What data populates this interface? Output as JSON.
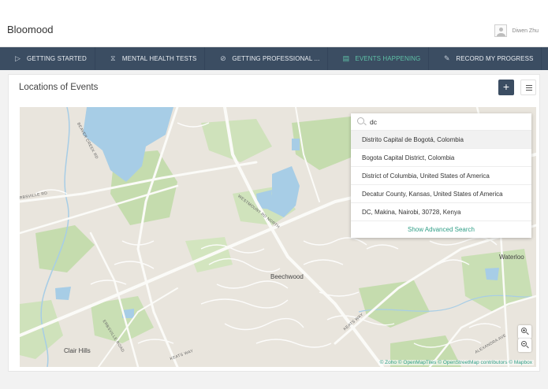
{
  "app": {
    "brand": "Bloomood"
  },
  "user": {
    "name": "Diwen Zhu"
  },
  "nav": {
    "items": [
      {
        "label": "GETTING STARTED",
        "icon": "play-outline-icon",
        "active": false
      },
      {
        "label": "MENTAL HEALTH TESTS",
        "icon": "hourglass-icon",
        "active": false
      },
      {
        "label": "GETTING PROFESSIONAL ...",
        "icon": "compass-icon",
        "active": false
      },
      {
        "label": "EVENTS HAPPENING",
        "icon": "calendar-icon",
        "active": true
      },
      {
        "label": "RECORD MY PROGRESS",
        "icon": "pencil-icon",
        "active": false
      }
    ],
    "more_icon": "vertical-ellipsis-icon"
  },
  "card": {
    "title": "Locations of Events",
    "add_label": "+",
    "menu_icon": "hamburger-menu-icon"
  },
  "search": {
    "value": "dc",
    "results": [
      "Distrito Capital de Bogotá, Colombia",
      "Bogota Capital District, Colombia",
      "District of Columbia, United States of America",
      "Decatur County, Kansas, United States of America",
      "DC, Makina, Nairobi, 30728, Kenya"
    ],
    "advanced_label": "Show Advanced Search"
  },
  "map": {
    "places": [
      "Waterloo",
      "Beechwood",
      "Clair Hills"
    ],
    "roads": [
      "BEAVER CREEK RD",
      "WESTMOUNT RD NORTH",
      "ERBSVILLE ROAD",
      "KEATS WAY",
      "KEATS WAY",
      "ALEXANDRA AVE",
      "ERBSVILLE RD"
    ],
    "attribution": "© Zoho © OpenMapTiles © OpenStreetMap contributors © Mapbox"
  },
  "colors": {
    "nav_bg": "#3b4d62",
    "accent": "#5fc1a7",
    "water": "#a7cde6",
    "park": "#c5dcae",
    "land": "#e8e4dc"
  }
}
